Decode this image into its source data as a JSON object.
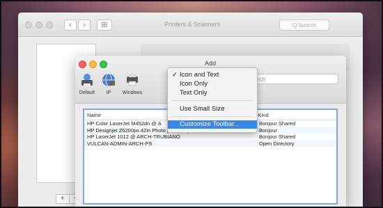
{
  "main_window": {
    "title": "Printers & Scanners",
    "back_glyph": "‹",
    "forward_glyph": "›",
    "grid_glyph": "⊞",
    "search_placeholder": "Q Search",
    "add_glyph": "+",
    "remove_glyph": "−"
  },
  "add_dialog": {
    "title": "Add",
    "toolbar": [
      {
        "label": "Default",
        "icon": "printer-icon"
      },
      {
        "label": "IP",
        "icon": "globe-icon"
      },
      {
        "label": "Windows",
        "icon": "windows-printer-icon"
      }
    ],
    "search_placeholder": "earch",
    "search_label": "earch",
    "columns": {
      "name": "Name",
      "sort_arrow": "^",
      "kind": "Kind"
    },
    "rows": [
      {
        "name": "HP Color LaserJet M452dn @ A",
        "kind": "Bonjour Shared"
      },
      {
        "name": "HP Designjet Z6200ps 42in Photo [79F26C]",
        "kind": "Bonjour"
      },
      {
        "name": "HP LaserJet 1012 @ ARCH-TRUBIANO",
        "kind": "Bonjour Shared"
      },
      {
        "name": "VULCAN-ADMIN-ARCH-PS",
        "kind": "Open Directory"
      }
    ]
  },
  "context_menu": {
    "check_glyph": "✓",
    "items": [
      {
        "label": "Icon and Text",
        "checked": true
      },
      {
        "label": "Icon Only",
        "checked": false
      },
      {
        "label": "Text Only",
        "checked": false
      },
      {
        "label": "Use Small Size",
        "checked": false
      },
      {
        "label": "Customize Toolbar...",
        "highlighted": true
      }
    ]
  },
  "colors": {
    "highlight": "#3a87e6",
    "list_border": "#7fa9de",
    "close": "#fc605c",
    "minimize": "#fdbc40",
    "zoom": "#34c84a"
  }
}
